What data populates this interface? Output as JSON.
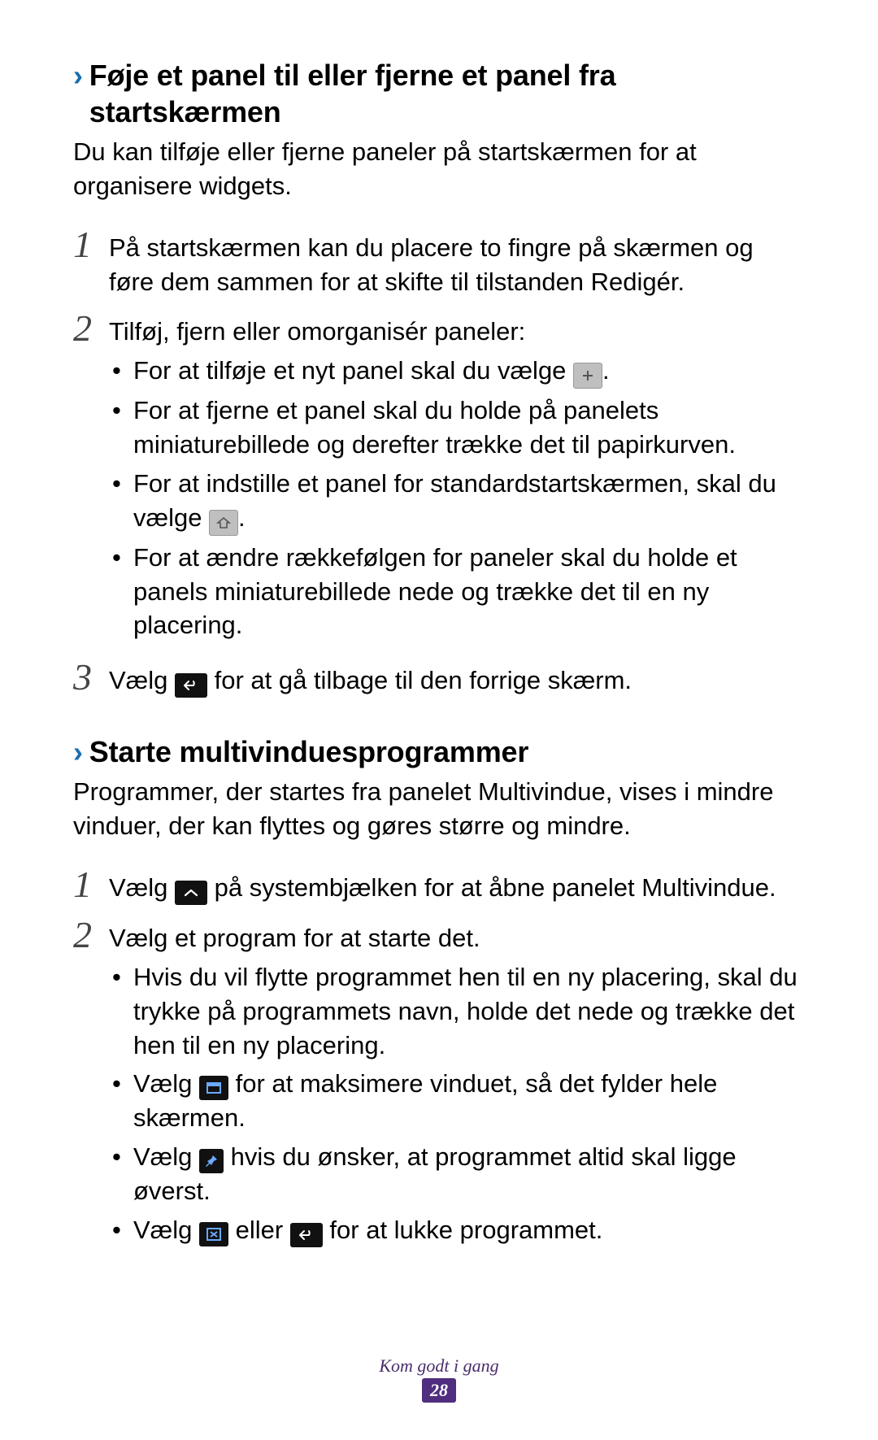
{
  "section1": {
    "heading": "Føje et panel til eller fjerne et panel fra startskærmen",
    "intro": "Du kan tilføje eller fjerne paneler på startskærmen for at organisere widgets.",
    "step1": "På startskærmen kan du placere to fingre på skærmen og føre dem sammen for at skifte til tilstanden Redigér.",
    "step2_lead": "Tilføj, fjern eller omorganisér paneler:",
    "step2_b1_a": "For at tilføje et nyt panel skal du vælge ",
    "step2_b1_b": ".",
    "step2_b2": "For at fjerne et panel skal du holde på panelets miniaturebillede og derefter trække det til papirkurven.",
    "step2_b3_a": "For at indstille et panel for standardstartskærmen, skal du vælge ",
    "step2_b3_b": ".",
    "step2_b4": "For at ændre rækkefølgen for paneler skal du holde et panels miniaturebillede nede og trække det til en ny placering.",
    "step3_a": "Vælg ",
    "step3_b": " for at gå tilbage til den forrige skærm."
  },
  "section2": {
    "heading": "Starte multivinduesprogrammer",
    "intro": "Programmer, der startes fra panelet Multivindue, vises i mindre vinduer, der kan flyttes og gøres større og mindre.",
    "step1_a": "Vælg ",
    "step1_b": " på systembjælken for at åbne panelet Multivindue.",
    "step2_lead": "Vælg et program for at starte det.",
    "step2_b1": "Hvis du vil flytte programmet hen til en ny placering, skal du trykke på programmets navn, holde det nede og trække det hen til en ny placering.",
    "step2_b2_a": "Vælg ",
    "step2_b2_b": " for at maksimere vinduet, så det fylder hele skærmen.",
    "step2_b3_a": "Vælg ",
    "step2_b3_b": " hvis du ønsker, at programmet altid skal ligge øverst.",
    "step2_b4_a": "Vælg ",
    "step2_b4_mid": " eller ",
    "step2_b4_b": " for at lukke programmet."
  },
  "nums": {
    "n1": "1",
    "n2": "2",
    "n3": "3"
  },
  "footer": {
    "title": "Kom godt i gang",
    "page": "28"
  }
}
